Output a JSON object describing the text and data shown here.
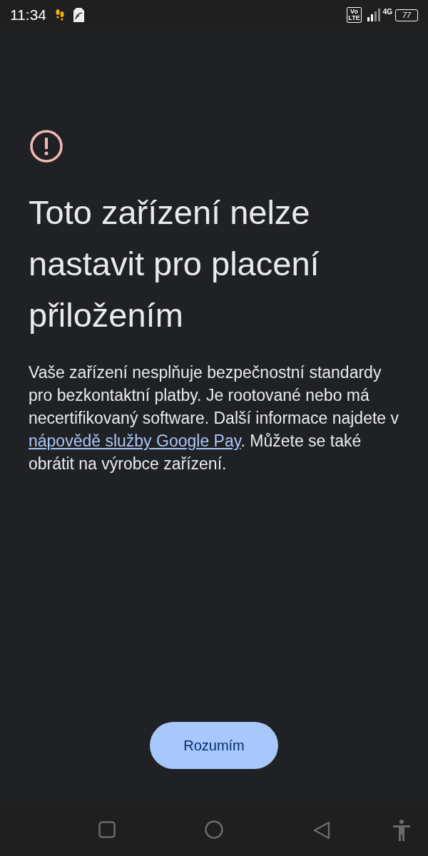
{
  "status_bar": {
    "time": "11:34",
    "volte": [
      "Vo",
      "LTE"
    ],
    "network": "4G",
    "battery": "77"
  },
  "title": "Toto zařízení nelze nastavit pro placení přiložením",
  "body": {
    "before": "Vaše zařízení nesplňuje bezpečnostní standardy pro bezkontaktní platby. Je rootované nebo má necertifikovaný software. Další informace najdete v",
    "link": "nápovědě služby Google Pay",
    "after": ". Můžete se také obrátit na výrobce zařízení."
  },
  "button": "Rozumím"
}
